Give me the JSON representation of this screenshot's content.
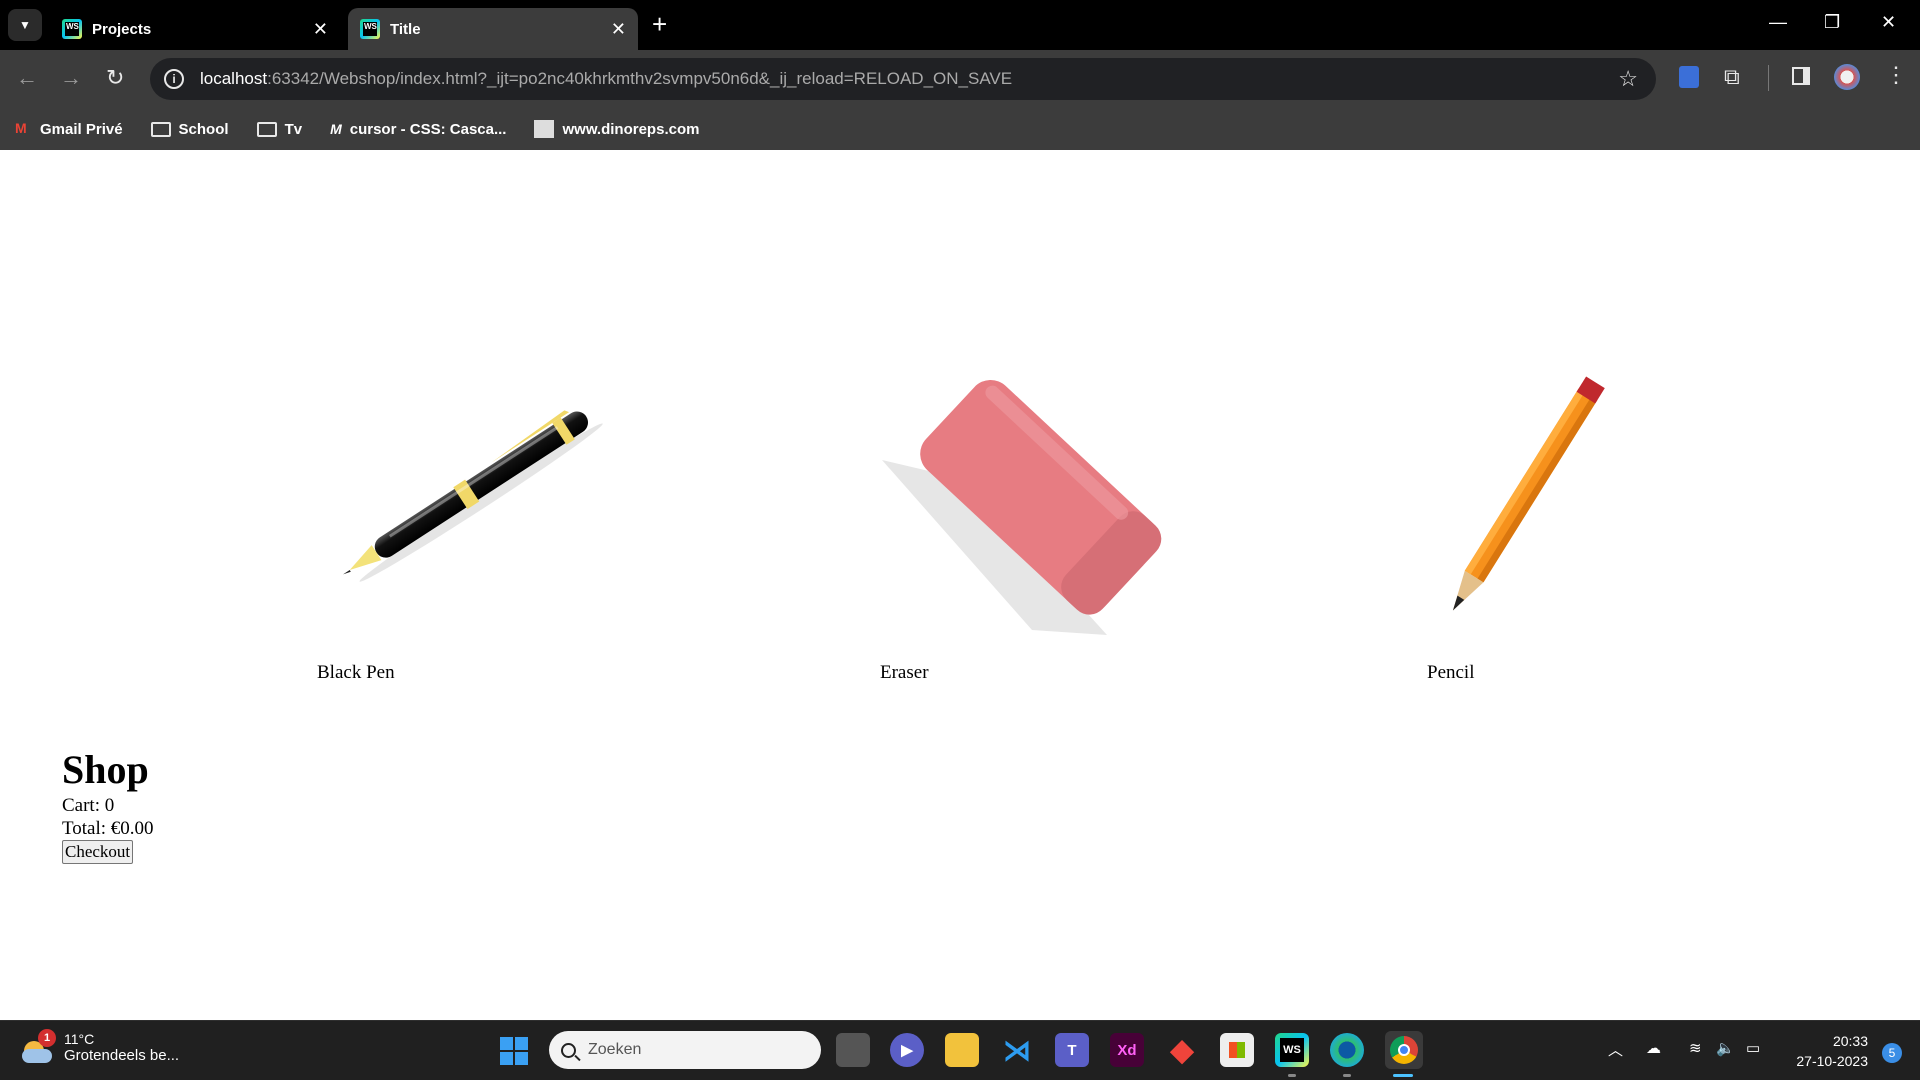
{
  "browser": {
    "tabs": [
      {
        "label": "Projects",
        "active": false
      },
      {
        "label": "Title",
        "active": true
      }
    ],
    "url_host": "localhost",
    "url_rest": ":63342/Webshop/index.html?_ijt=po2nc40khrkmthv2svmpv50n6d&_ij_reload=RELOAD_ON_SAVE",
    "bookmarks": [
      {
        "label": "Gmail Privé",
        "icon": "gmail-icon"
      },
      {
        "label": "School",
        "icon": "folder-icon"
      },
      {
        "label": "Tv",
        "icon": "folder-icon"
      },
      {
        "label": "cursor - CSS: Casca...",
        "icon": "cursor-icon"
      },
      {
        "label": "www.dinoreps.com",
        "icon": "site-icon"
      }
    ]
  },
  "page": {
    "products": [
      {
        "name": "Black Pen",
        "image": "pen-icon"
      },
      {
        "name": "Eraser",
        "image": "eraser-icon"
      },
      {
        "name": "Pencil",
        "image": "pencil-icon"
      }
    ],
    "shop_title": "Shop",
    "cart_line": "Cart: 0",
    "total_line": "Total: €0.00",
    "checkout_label": "Checkout"
  },
  "taskbar": {
    "weather_temp": "11°C",
    "weather_desc": "Grotendeels be...",
    "weather_badge": "1",
    "search_placeholder": "Zoeken",
    "time": "20:33",
    "date": "27-10-2023",
    "notification_count": "5",
    "apps": [
      "task-view-icon",
      "meet-icon",
      "file-explorer-icon",
      "vscode-icon",
      "teams-icon",
      "xd-icon",
      "anydesk-icon",
      "store-icon",
      "webstorm-icon",
      "edge-icon",
      "chrome-icon"
    ]
  }
}
